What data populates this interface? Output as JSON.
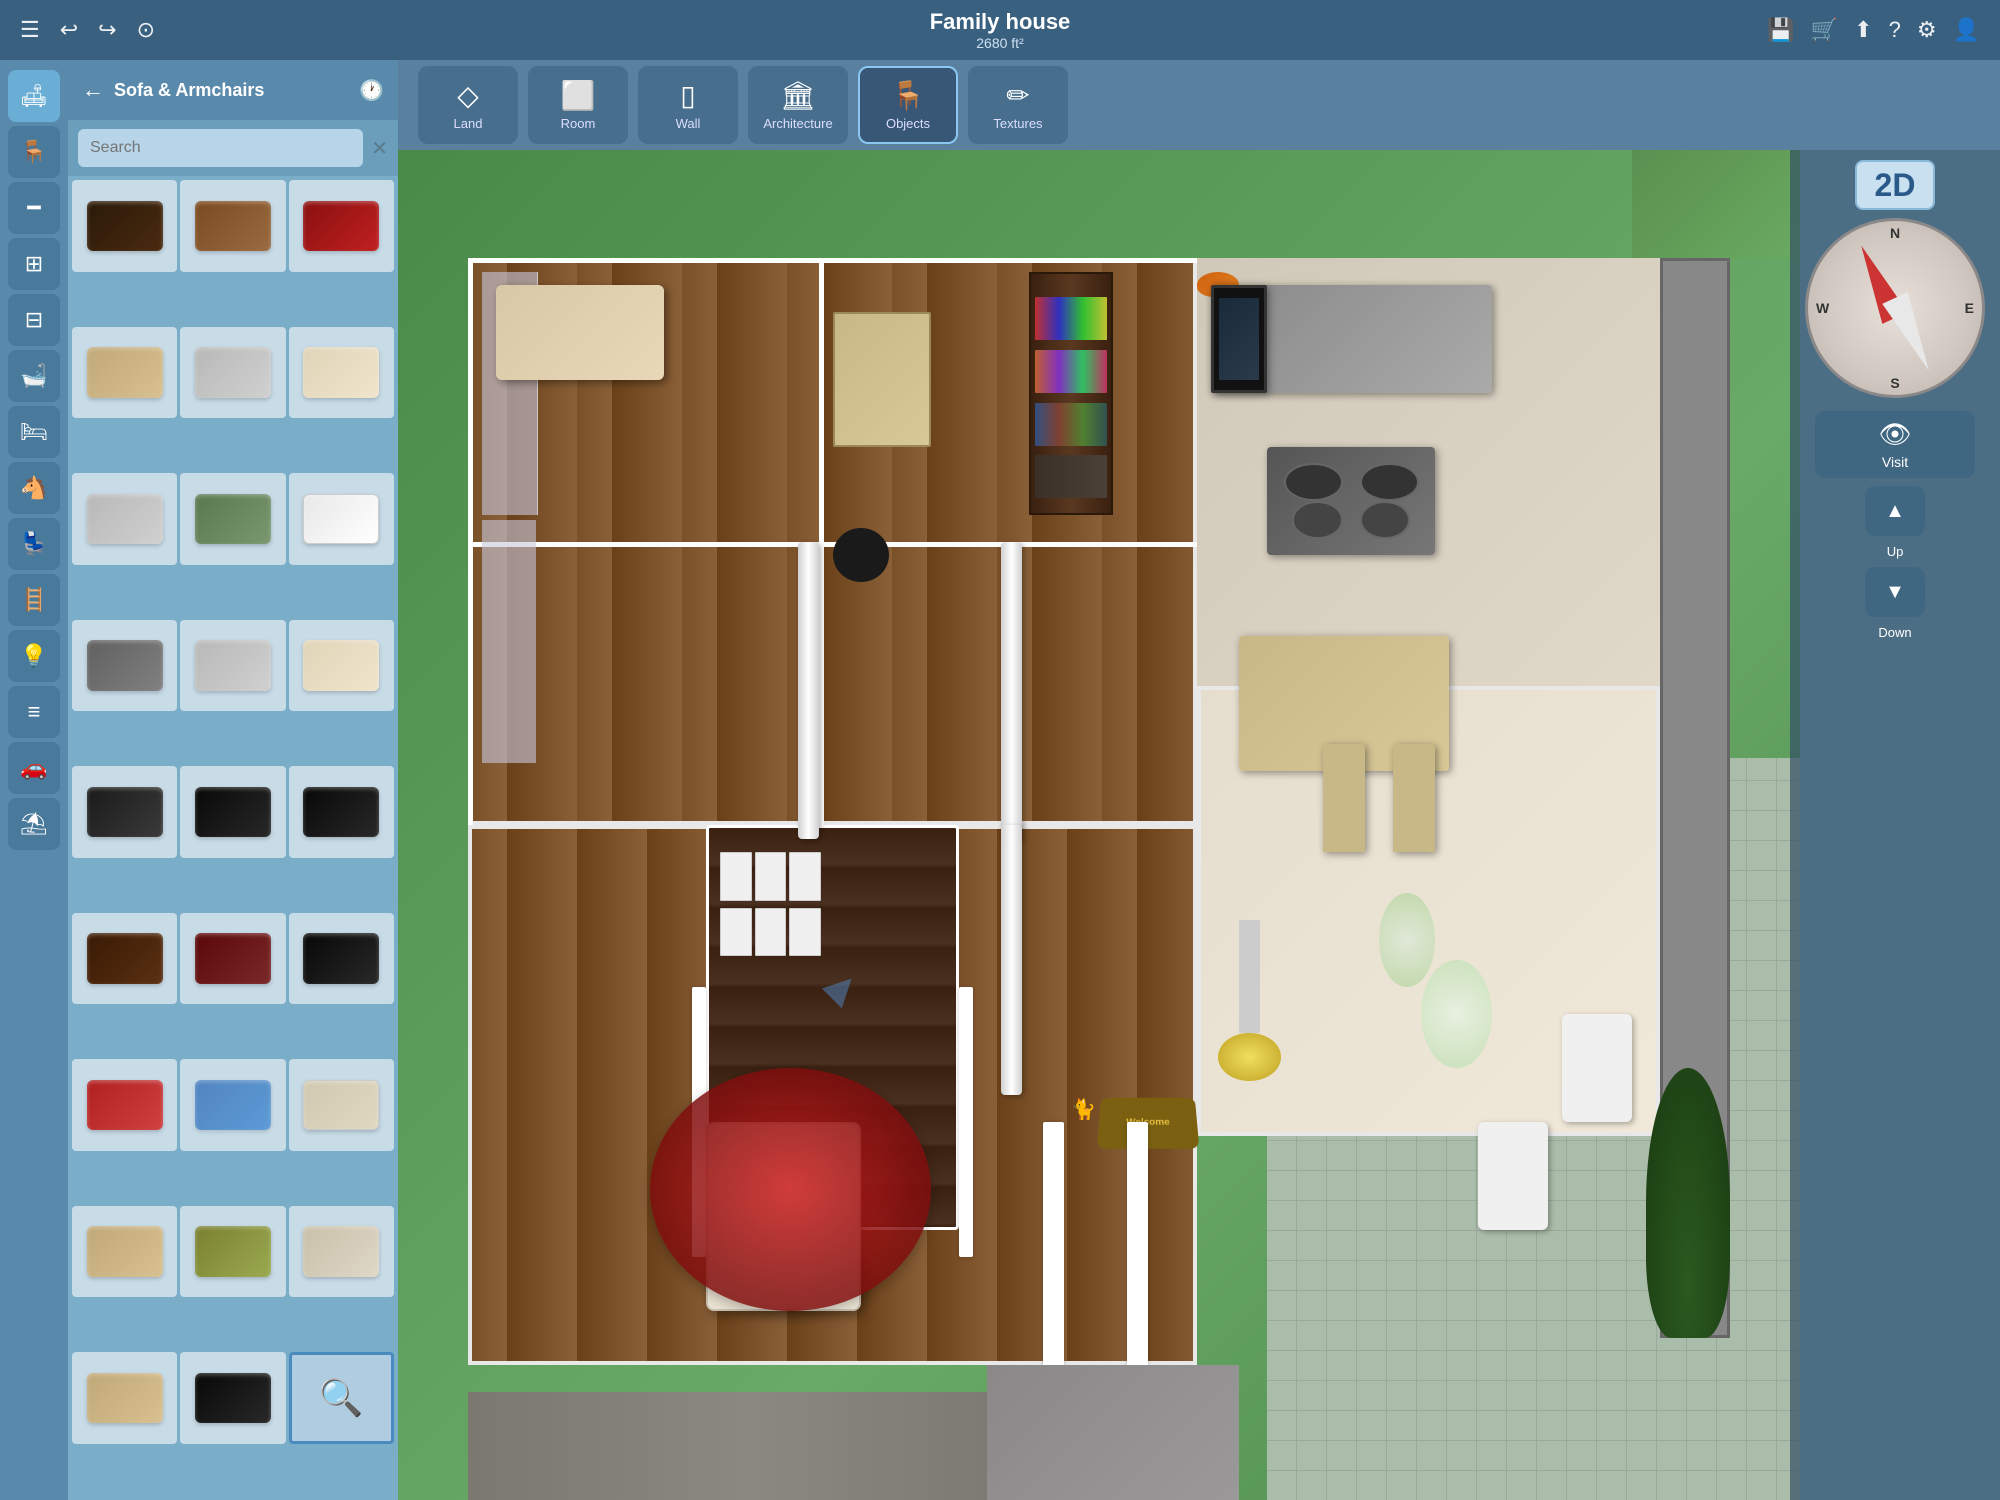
{
  "app": {
    "title": "Family house",
    "subtitle": "2680 ft²",
    "view_mode": "2D"
  },
  "topbar": {
    "menu_icon": "☰",
    "undo_icon": "↩",
    "redo_icon": "↪",
    "camera_icon": "⊙",
    "save_icon": "💾",
    "cart_icon": "🛒",
    "share_icon": "⬆",
    "help_icon": "?",
    "settings_icon": "⚙",
    "account_icon": "👤"
  },
  "sidebar": {
    "back_label": "←",
    "title": "Sofa & Armchairs",
    "history_icon": "🕐",
    "search_placeholder": "Search",
    "search_clear": "✕",
    "icons": [
      {
        "name": "sofa",
        "icon": "🛋",
        "active": true
      },
      {
        "name": "chair",
        "icon": "🪑"
      },
      {
        "name": "table",
        "icon": "▬"
      },
      {
        "name": "kitchen",
        "icon": "⊞"
      },
      {
        "name": "stove",
        "icon": "⊟"
      },
      {
        "name": "bath",
        "icon": "🛁"
      },
      {
        "name": "bed",
        "icon": "🛏"
      },
      {
        "name": "rocking",
        "icon": "🪑"
      },
      {
        "name": "office",
        "icon": "🪑"
      },
      {
        "name": "ladder",
        "icon": "⊞"
      },
      {
        "name": "lamp",
        "icon": "💡"
      },
      {
        "name": "radiator",
        "icon": "≡"
      },
      {
        "name": "vehicle",
        "icon": "🚗"
      },
      {
        "name": "outdoor",
        "icon": "⛱"
      }
    ],
    "items": [
      {
        "id": 1,
        "color": "dark"
      },
      {
        "id": 2,
        "color": "brown"
      },
      {
        "id": 3,
        "color": "red"
      },
      {
        "id": 4,
        "color": "beige"
      },
      {
        "id": 5,
        "color": "lgray"
      },
      {
        "id": 6,
        "color": "cream"
      },
      {
        "id": 7,
        "color": "lgray2"
      },
      {
        "id": 8,
        "color": "green2"
      },
      {
        "id": 9,
        "color": "white"
      },
      {
        "id": 10,
        "color": "dgray"
      },
      {
        "id": 11,
        "color": "lgray3"
      },
      {
        "id": 12,
        "color": "cream2"
      },
      {
        "id": 13,
        "color": "charcoal"
      },
      {
        "id": 14,
        "color": "black"
      },
      {
        "id": 15,
        "color": "black2"
      },
      {
        "id": 16,
        "color": "dkbrown"
      },
      {
        "id": 17,
        "color": "burgundy"
      },
      {
        "id": 18,
        "color": "lbrown"
      },
      {
        "id": 19,
        "color": "black3"
      },
      {
        "id": 20,
        "color": "pink"
      },
      {
        "id": 21,
        "color": "blue"
      },
      {
        "id": 22,
        "color": "beige2"
      },
      {
        "id": 23,
        "color": "olive"
      },
      {
        "id": 24,
        "color": "lgray4"
      },
      {
        "id": 25,
        "color": "beige3"
      },
      {
        "id": 26,
        "color": "black4"
      },
      {
        "id": 27,
        "color": "search",
        "is_search": true
      }
    ]
  },
  "toolbar": {
    "items": [
      {
        "id": "land",
        "icon": "◇",
        "label": "Land"
      },
      {
        "id": "room",
        "icon": "⬜",
        "label": "Room"
      },
      {
        "id": "wall",
        "icon": "▯",
        "label": "Wall"
      },
      {
        "id": "architecture",
        "icon": "🏛",
        "label": "Architecture"
      },
      {
        "id": "objects",
        "icon": "🪑",
        "label": "Objects",
        "active": true
      },
      {
        "id": "textures",
        "icon": "✏",
        "label": "Textures"
      }
    ]
  },
  "overlay": {
    "view_2d": "2D",
    "visit_label": "Visit",
    "up_label": "Up",
    "down_label": "Down",
    "compass_letters": {
      "n": "N",
      "s": "S",
      "e": "E",
      "w": "W"
    }
  }
}
